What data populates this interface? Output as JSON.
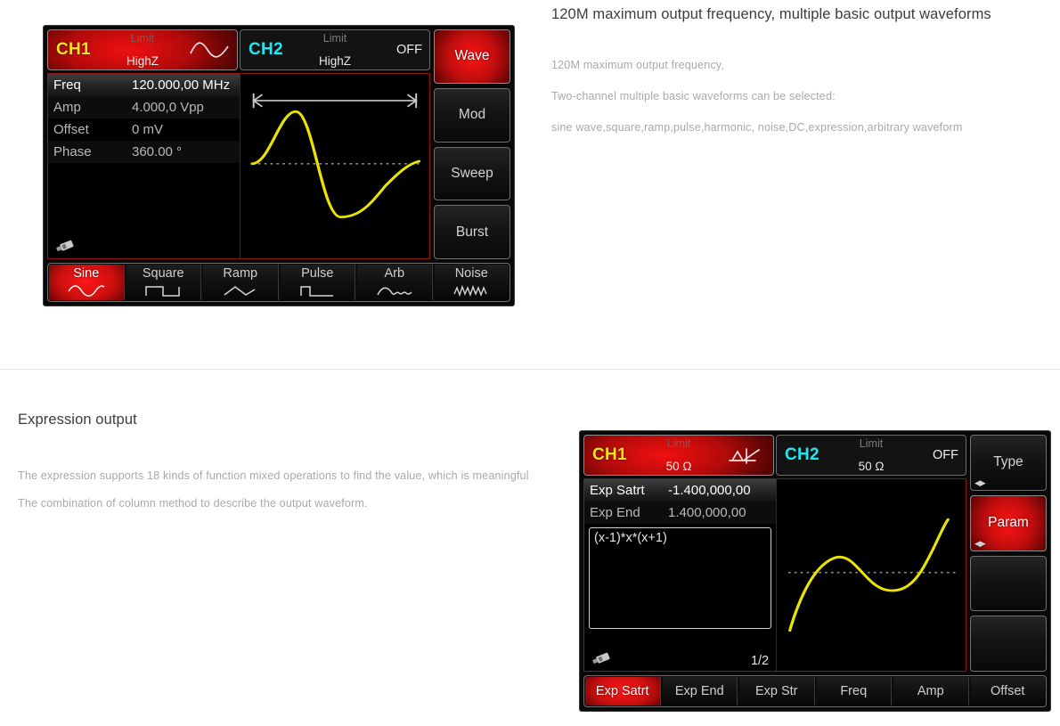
{
  "top_section": {
    "heading": "120M maximum output frequency, multiple basic output waveforms",
    "paragraphs": [
      "120M maximum output frequency,",
      "Two-channel multiple basic waveforms can be selected:",
      "sine wave,square,ramp,pulse,harmonic, noise,DC,expression,arbitrary waveform"
    ]
  },
  "bottom_section": {
    "heading": "Expression output",
    "paragraphs": [
      "The expression supports 18 kinds of function mixed operations to find the value, which is meaningful The combination of column method to describe the output waveform."
    ]
  },
  "device_top": {
    "channels": [
      {
        "name": "CH1",
        "limit_label": "Limit",
        "impedance": "HighZ",
        "state": "",
        "icon": "sine-wave-icon",
        "active": true
      },
      {
        "name": "CH2",
        "limit_label": "Limit",
        "impedance": "HighZ",
        "state": "OFF",
        "icon": "",
        "active": false
      }
    ],
    "params": [
      {
        "key": "Freq",
        "value": "120.000,00 MHz",
        "selected": true
      },
      {
        "key": "Amp",
        "value": "4.000,0 Vpp",
        "selected": false
      },
      {
        "key": "Offset",
        "value": "0 mV",
        "selected": false
      },
      {
        "key": "Phase",
        "value": "360.00 °",
        "selected": false
      }
    ],
    "status_icon": "usb-drive-icon",
    "soft_keys": [
      {
        "label": "Wave",
        "active": true
      },
      {
        "label": "Mod",
        "active": false
      },
      {
        "label": "Sweep",
        "active": false
      },
      {
        "label": "Burst",
        "active": false
      }
    ],
    "menu_keys": [
      {
        "label": "Sine",
        "icon": "sine-wave-icon",
        "active": true
      },
      {
        "label": "Square",
        "icon": "square-wave-icon",
        "active": false
      },
      {
        "label": "Ramp",
        "icon": "ramp-wave-icon",
        "active": false
      },
      {
        "label": "Pulse",
        "icon": "pulse-wave-icon",
        "active": false
      },
      {
        "label": "Arb",
        "icon": "arbitrary-wave-icon",
        "active": false
      },
      {
        "label": "Noise",
        "icon": "noise-wave-icon",
        "active": false
      }
    ],
    "plot": {
      "waveform": "sine",
      "trace_color": "#ebe400",
      "has_span_arrow": true
    }
  },
  "device_bottom": {
    "channels": [
      {
        "name": "CH1",
        "limit_label": "Limit",
        "impedance": "50 Ω",
        "state": "",
        "icon": "expression-axes-icon",
        "active": true
      },
      {
        "name": "CH2",
        "limit_label": "Limit",
        "impedance": "50 Ω",
        "state": "OFF",
        "icon": "",
        "active": false
      }
    ],
    "params": [
      {
        "key": "Exp Satrt",
        "value": "-1.400,000,00",
        "selected": true
      },
      {
        "key": "Exp End",
        "value": "1.400,000,00",
        "selected": false
      }
    ],
    "expression": "(x-1)*x*(x+1)",
    "page_indicator": "1/2",
    "status_icon": "usb-drive-icon",
    "soft_keys": [
      {
        "label": "Type",
        "active": false,
        "arrows": "◀▶"
      },
      {
        "label": "Param",
        "active": true,
        "arrows": "◀▶"
      },
      {
        "label": "",
        "active": false,
        "arrows": ""
      },
      {
        "label": "",
        "active": false,
        "arrows": ""
      }
    ],
    "menu_keys": [
      {
        "label": "Exp Satrt",
        "active": true
      },
      {
        "label": "Exp End",
        "active": false
      },
      {
        "label": "Exp Str",
        "active": false
      },
      {
        "label": "Freq",
        "active": false
      },
      {
        "label": "Amp",
        "active": false
      },
      {
        "label": "Offset",
        "active": false
      }
    ],
    "plot": {
      "waveform": "cubic",
      "trace_color": "#ebe400",
      "has_span_arrow": false
    }
  },
  "colors": {
    "accent_red": "#e01010",
    "ch1_yellow": "#ffe11a",
    "ch2_cyan": "#1ee7f0",
    "trace_yellow": "#ebe400",
    "body_text": "#a7a9ac",
    "heading_text": "#3c3c3c",
    "divider": "#e6e8ea"
  }
}
